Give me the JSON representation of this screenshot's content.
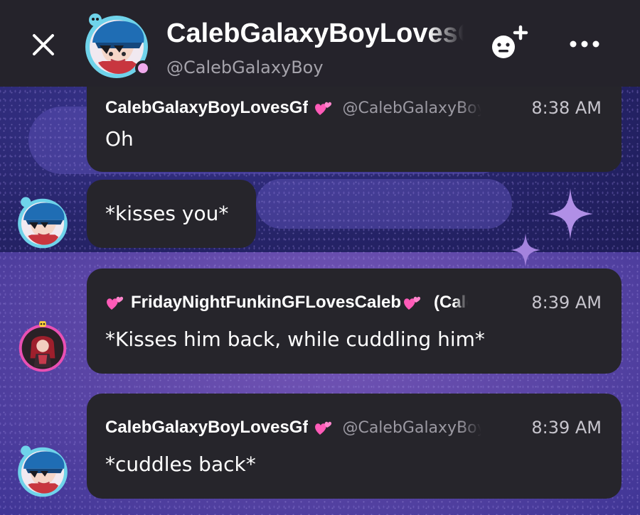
{
  "header": {
    "title": "CalebGalaxyBoyLovesGf",
    "handle": "@CalebGalaxyBoy",
    "close_icon": "close-icon",
    "add_member_icon": "add-member-icon",
    "more_icon": "more-dots-icon",
    "online_color": "#f0a9ec"
  },
  "messages": [
    {
      "sender": "CalebGalaxyBoyLovesGf",
      "sender_suffix_icon": "sparkling-hearts-icon",
      "handle": "@CalebGalaxyBoy",
      "time": "8:38 AM",
      "text": "Oh"
    },
    {
      "text": "*kisses you*"
    },
    {
      "sender": "FridayNightFunkinGFLovesCaleb",
      "sender_prefix_icon": "sparkling-hearts-icon",
      "sender_suffix_icon": "sparkling-hearts-icon",
      "handle": "(Caleb",
      "time": "8:39 AM",
      "text": "*Kisses him back, while cuddling him*"
    },
    {
      "sender": "CalebGalaxyBoyLovesGf",
      "sender_suffix_icon": "sparkling-hearts-icon",
      "handle": "@CalebGalaxyBoy",
      "time": "8:39 AM",
      "text": "*cuddles back*"
    }
  ],
  "colors": {
    "header_bg": "#25232b",
    "bubble_bg": "#26252b",
    "accent_pink": "#ff5bb8",
    "avatar_ring_blue": "#6fd3ea",
    "avatar_ring_pink": "#e94fb3"
  }
}
